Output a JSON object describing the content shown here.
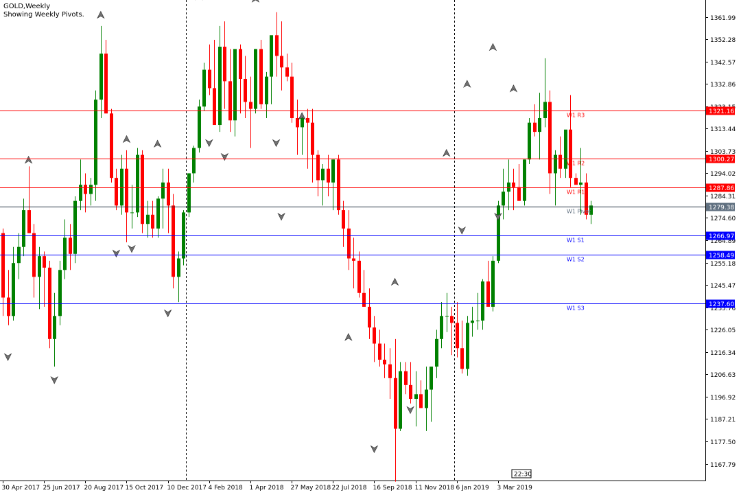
{
  "header": {
    "symbol_line": "GOLD,Weekly",
    "indicator_line": "Showing Weekly Pivots."
  },
  "colors": {
    "bull": "#008000",
    "bear": "#ff0000",
    "resistance": "#ff0000",
    "support": "#0000ff",
    "pivot": "#203040",
    "grid": "#000000",
    "label_bg_resistance": "#ff0000",
    "label_bg_support": "#0000ff",
    "label_bg_pivot": "#607080"
  },
  "time_marker": "22:30",
  "chart_data": {
    "type": "candlestick",
    "title": "GOLD,Weekly",
    "subtitle": "Showing Weekly Pivots.",
    "ylim": [
      1160.5,
      1369.3
    ],
    "y_ticks": [
      "1361.99",
      "1352.28",
      "1342.57",
      "1332.86",
      "1323.15",
      "1313.44",
      "1303.73",
      "1294.02",
      "1284.31",
      "1274.60",
      "1264.89",
      "1255.18",
      "1245.47",
      "1235.76",
      "1226.05",
      "1216.34",
      "1206.63",
      "1196.92",
      "1187.21",
      "1177.50",
      "1167.79"
    ],
    "x_labels": [
      {
        "i": 0,
        "label": "30 Apr 2017"
      },
      {
        "i": 8,
        "label": "25 Jun 2017"
      },
      {
        "i": 16,
        "label": "20 Aug 2017"
      },
      {
        "i": 24,
        "label": "15 Oct 2017"
      },
      {
        "i": 32,
        "label": "10 Dec 2017"
      },
      {
        "i": 40,
        "label": "4 Feb 2018"
      },
      {
        "i": 48,
        "label": "1 Apr 2018"
      },
      {
        "i": 56,
        "label": "27 May 2018"
      },
      {
        "i": 64,
        "label": "22 Jul 2018"
      },
      {
        "i": 72,
        "label": "16 Sep 2018"
      },
      {
        "i": 80,
        "label": "11 Nov 2018"
      },
      {
        "i": 88,
        "label": "6 Jan 2019"
      },
      {
        "i": 96,
        "label": "3 Mar 2019"
      }
    ],
    "separators": [
      36,
      88
    ],
    "pivot_levels": [
      {
        "name": "W1 R3",
        "value": 1321.16,
        "label": "1321.16",
        "kind": "resistance"
      },
      {
        "name": "W1 R2",
        "value": 1300.27,
        "label": "1300.27",
        "kind": "resistance"
      },
      {
        "name": "W1 R1",
        "value": 1287.86,
        "label": "1287.86",
        "kind": "resistance"
      },
      {
        "name": "W1 Pivot",
        "value": 1279.38,
        "label": "1279.38",
        "kind": "pivot"
      },
      {
        "name": "W1 S1",
        "value": 1266.97,
        "label": "1266.97",
        "kind": "support"
      },
      {
        "name": "W1 S2",
        "value": 1258.49,
        "label": "1258.49",
        "kind": "support"
      },
      {
        "name": "W1 S3",
        "value": 1237.6,
        "label": "1237.60",
        "kind": "support"
      }
    ],
    "ohlc": [
      [
        1268,
        1270,
        1232,
        1240
      ],
      [
        1240,
        1252,
        1228,
        1232
      ],
      [
        1232,
        1262,
        1230,
        1255
      ],
      [
        1255,
        1268,
        1248,
        1262
      ],
      [
        1262,
        1283,
        1258,
        1278
      ],
      [
        1278,
        1297,
        1268,
        1268
      ],
      [
        1268,
        1272,
        1240,
        1249
      ],
      [
        1249,
        1262,
        1235,
        1258
      ],
      [
        1258,
        1260,
        1236,
        1253
      ],
      [
        1253,
        1256,
        1218,
        1222
      ],
      [
        1222,
        1242,
        1210,
        1232
      ],
      [
        1232,
        1256,
        1228,
        1252
      ],
      [
        1252,
        1274,
        1248,
        1266
      ],
      [
        1266,
        1272,
        1252,
        1259
      ],
      [
        1259,
        1284,
        1255,
        1282
      ],
      [
        1282,
        1300,
        1278,
        1289
      ],
      [
        1289,
        1294,
        1277,
        1285
      ],
      [
        1285,
        1292,
        1280,
        1289
      ],
      [
        1289,
        1330,
        1282,
        1326
      ],
      [
        1326,
        1358,
        1318,
        1346
      ],
      [
        1346,
        1352,
        1320,
        1320
      ],
      [
        1320,
        1322,
        1290,
        1292
      ],
      [
        1292,
        1296,
        1278,
        1280
      ],
      [
        1280,
        1302,
        1276,
        1296
      ],
      [
        1296,
        1304,
        1264,
        1277
      ],
      [
        1277,
        1289,
        1270,
        1277
      ],
      [
        1277,
        1305,
        1275,
        1302
      ],
      [
        1302,
        1304,
        1268,
        1272
      ],
      [
        1272,
        1282,
        1266,
        1276
      ],
      [
        1276,
        1282,
        1266,
        1270
      ],
      [
        1270,
        1284,
        1266,
        1283
      ],
      [
        1283,
        1296,
        1270,
        1290
      ],
      [
        1290,
        1296,
        1268,
        1280
      ],
      [
        1280,
        1285,
        1244,
        1249
      ],
      [
        1249,
        1260,
        1238,
        1257
      ],
      [
        1257,
        1278,
        1254,
        1277
      ],
      [
        1277,
        1294,
        1275,
        1294
      ],
      [
        1294,
        1306,
        1290,
        1305
      ],
      [
        1305,
        1326,
        1303,
        1323
      ],
      [
        1323,
        1342,
        1321,
        1339
      ],
      [
        1339,
        1350,
        1328,
        1331
      ],
      [
        1331,
        1352,
        1322,
        1315
      ],
      [
        1315,
        1358,
        1312,
        1349
      ],
      [
        1349,
        1360,
        1322,
        1334
      ],
      [
        1334,
        1348,
        1312,
        1317
      ],
      [
        1317,
        1342,
        1310,
        1348
      ],
      [
        1348,
        1350,
        1320,
        1335
      ],
      [
        1335,
        1345,
        1318,
        1325
      ],
      [
        1325,
        1336,
        1305,
        1322
      ],
      [
        1322,
        1348,
        1320,
        1348
      ],
      [
        1348,
        1352,
        1322,
        1324
      ],
      [
        1324,
        1338,
        1318,
        1336
      ],
      [
        1336,
        1350,
        1324,
        1354
      ],
      [
        1354,
        1364,
        1336,
        1345
      ],
      [
        1345,
        1360,
        1330,
        1340
      ],
      [
        1340,
        1346,
        1334,
        1336
      ],
      [
        1336,
        1342,
        1316,
        1318
      ],
      [
        1318,
        1326,
        1302,
        1314
      ],
      [
        1314,
        1320,
        1302,
        1318
      ],
      [
        1318,
        1322,
        1296,
        1316
      ],
      [
        1316,
        1322,
        1290,
        1302
      ],
      [
        1302,
        1304,
        1284,
        1291
      ],
      [
        1291,
        1298,
        1280,
        1296
      ],
      [
        1296,
        1302,
        1284,
        1290
      ],
      [
        1290,
        1300,
        1278,
        1300
      ],
      [
        1300,
        1302,
        1276,
        1278
      ],
      [
        1278,
        1282,
        1262,
        1270
      ],
      [
        1270,
        1278,
        1252,
        1257
      ],
      [
        1257,
        1266,
        1244,
        1256
      ],
      [
        1256,
        1260,
        1240,
        1242
      ],
      [
        1242,
        1252,
        1236,
        1236
      ],
      [
        1236,
        1244,
        1222,
        1227
      ],
      [
        1227,
        1232,
        1212,
        1220
      ],
      [
        1220,
        1226,
        1210,
        1213
      ],
      [
        1213,
        1220,
        1205,
        1211
      ],
      [
        1211,
        1218,
        1196,
        1205
      ],
      [
        1205,
        1222,
        1160,
        1183
      ],
      [
        1183,
        1212,
        1182,
        1208
      ],
      [
        1208,
        1212,
        1198,
        1202
      ],
      [
        1202,
        1212,
        1194,
        1196
      ],
      [
        1196,
        1208,
        1184,
        1198
      ],
      [
        1198,
        1204,
        1192,
        1192
      ],
      [
        1192,
        1210,
        1182,
        1200
      ],
      [
        1200,
        1210,
        1186,
        1210
      ],
      [
        1210,
        1226,
        1205,
        1222
      ],
      [
        1222,
        1238,
        1218,
        1232
      ],
      [
        1232,
        1242,
        1225,
        1232
      ],
      [
        1232,
        1236,
        1215,
        1229
      ],
      [
        1229,
        1238,
        1214,
        1218
      ],
      [
        1218,
        1230,
        1207,
        1209
      ],
      [
        1209,
        1232,
        1206,
        1229
      ],
      [
        1229,
        1236,
        1223,
        1230
      ],
      [
        1230,
        1242,
        1226,
        1230
      ],
      [
        1230,
        1248,
        1226,
        1247
      ],
      [
        1247,
        1256,
        1238,
        1236
      ],
      [
        1236,
        1258,
        1234,
        1256
      ],
      [
        1256,
        1282,
        1255,
        1280
      ],
      [
        1280,
        1296,
        1274,
        1286
      ],
      [
        1286,
        1300,
        1278,
        1290
      ],
      [
        1290,
        1296,
        1278,
        1288
      ],
      [
        1288,
        1298,
        1282,
        1282
      ],
      [
        1282,
        1300,
        1280,
        1300
      ],
      [
        1300,
        1318,
        1298,
        1316
      ],
      [
        1316,
        1324,
        1310,
        1312
      ],
      [
        1312,
        1329,
        1300,
        1318
      ],
      [
        1318,
        1344,
        1314,
        1325
      ],
      [
        1325,
        1330,
        1285,
        1294
      ],
      [
        1294,
        1304,
        1280,
        1302
      ],
      [
        1302,
        1310,
        1292,
        1296
      ],
      [
        1296,
        1312,
        1292,
        1313
      ],
      [
        1313,
        1328,
        1288,
        1292
      ],
      [
        1292,
        1294,
        1290,
        1289
      ],
      [
        1289,
        1305,
        1276,
        1290
      ],
      [
        1290,
        1294,
        1274,
        1276
      ],
      [
        1276,
        1282,
        1272,
        1280
      ]
    ],
    "fractals": [
      {
        "i": 1,
        "dir": "down",
        "value": 1215
      },
      {
        "i": 5,
        "dir": "up",
        "value": 1299
      },
      {
        "i": 10,
        "dir": "down",
        "value": 1205
      },
      {
        "i": 19,
        "dir": "up",
        "value": 1362
      },
      {
        "i": 22,
        "dir": "down",
        "value": 1260
      },
      {
        "i": 24,
        "dir": "up",
        "value": 1308
      },
      {
        "i": 25,
        "dir": "down",
        "value": 1262
      },
      {
        "i": 30,
        "dir": "up",
        "value": 1306
      },
      {
        "i": 32,
        "dir": "down",
        "value": 1234
      },
      {
        "i": 38,
        "dir": "up",
        "value": 1370
      },
      {
        "i": 40,
        "dir": "down",
        "value": 1308
      },
      {
        "i": 43,
        "dir": "down",
        "value": 1302
      },
      {
        "i": 49,
        "dir": "up",
        "value": 1369
      },
      {
        "i": 53,
        "dir": "down",
        "value": 1308
      },
      {
        "i": 54,
        "dir": "down",
        "value": 1276
      },
      {
        "i": 58,
        "dir": "up",
        "value": 1318
      },
      {
        "i": 67,
        "dir": "up",
        "value": 1222
      },
      {
        "i": 72,
        "dir": "down",
        "value": 1175
      },
      {
        "i": 76,
        "dir": "up",
        "value": 1246
      },
      {
        "i": 79,
        "dir": "down",
        "value": 1192
      },
      {
        "i": 86,
        "dir": "up",
        "value": 1302
      },
      {
        "i": 89,
        "dir": "down",
        "value": 1270
      },
      {
        "i": 90,
        "dir": "up",
        "value": 1332
      },
      {
        "i": 95,
        "dir": "up",
        "value": 1348
      },
      {
        "i": 96,
        "dir": "down",
        "value": 1276
      },
      {
        "i": 99,
        "dir": "up",
        "value": 1330
      }
    ],
    "grid": false,
    "legend": "none"
  }
}
